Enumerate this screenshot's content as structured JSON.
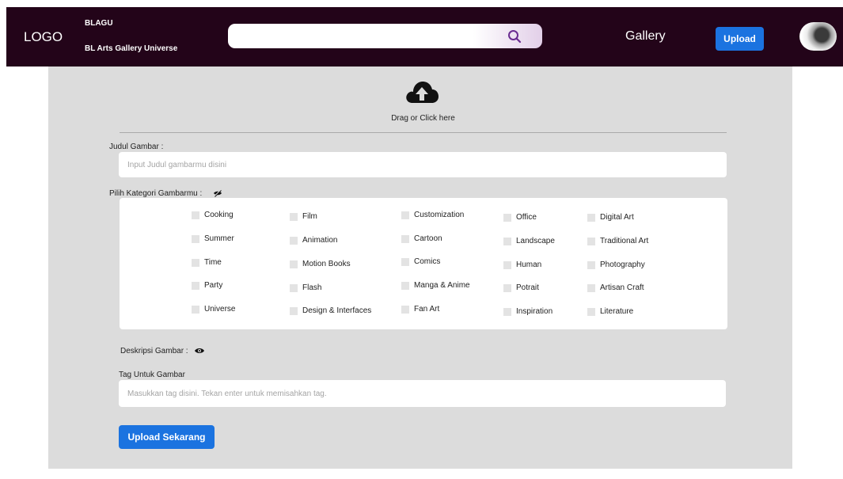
{
  "header": {
    "logo": "LOGO",
    "brand_title": "BLAGU",
    "brand_subtitle": "BL Arts Gallery Universe",
    "search_placeholder": "",
    "nav_gallery": "Gallery",
    "upload_label": "Upload",
    "icons": {
      "search": "search-icon",
      "avatar": "avatar-photo"
    }
  },
  "form": {
    "drop_text": "Drag or Click here",
    "title_label": "Judul Gambar :",
    "title_placeholder": "Input Judul gambarmu disini",
    "category_label": "Pilih Kategori Gambarmu :",
    "categories": [
      "Cooking",
      "Summer",
      "Time",
      "Party",
      "Universe",
      "Film",
      "Animation",
      "Motion Books",
      "Flash",
      "Design & Interfaces",
      "Customization",
      "Cartoon",
      "Comics",
      "Manga & Anime",
      "Fan Art",
      "Office",
      "Landscape",
      "Human",
      "Potrait",
      "Inspiration",
      "Digital Art",
      "Traditional Art",
      "Photography",
      "Artisan Craft",
      "Literature"
    ],
    "description_label": "Deskripsi Gambar :",
    "tag_label": "Tag Untuk Gambar",
    "tag_placeholder": "Masukkan tag disini. Tekan enter untuk memisahkan tag.",
    "submit_label": "Upload Sekarang"
  },
  "colors": {
    "header_bg": "#230419",
    "panel_bg": "#dcdcdc",
    "accent": "#1b73e0",
    "checkbox": "#e3e3e3"
  }
}
